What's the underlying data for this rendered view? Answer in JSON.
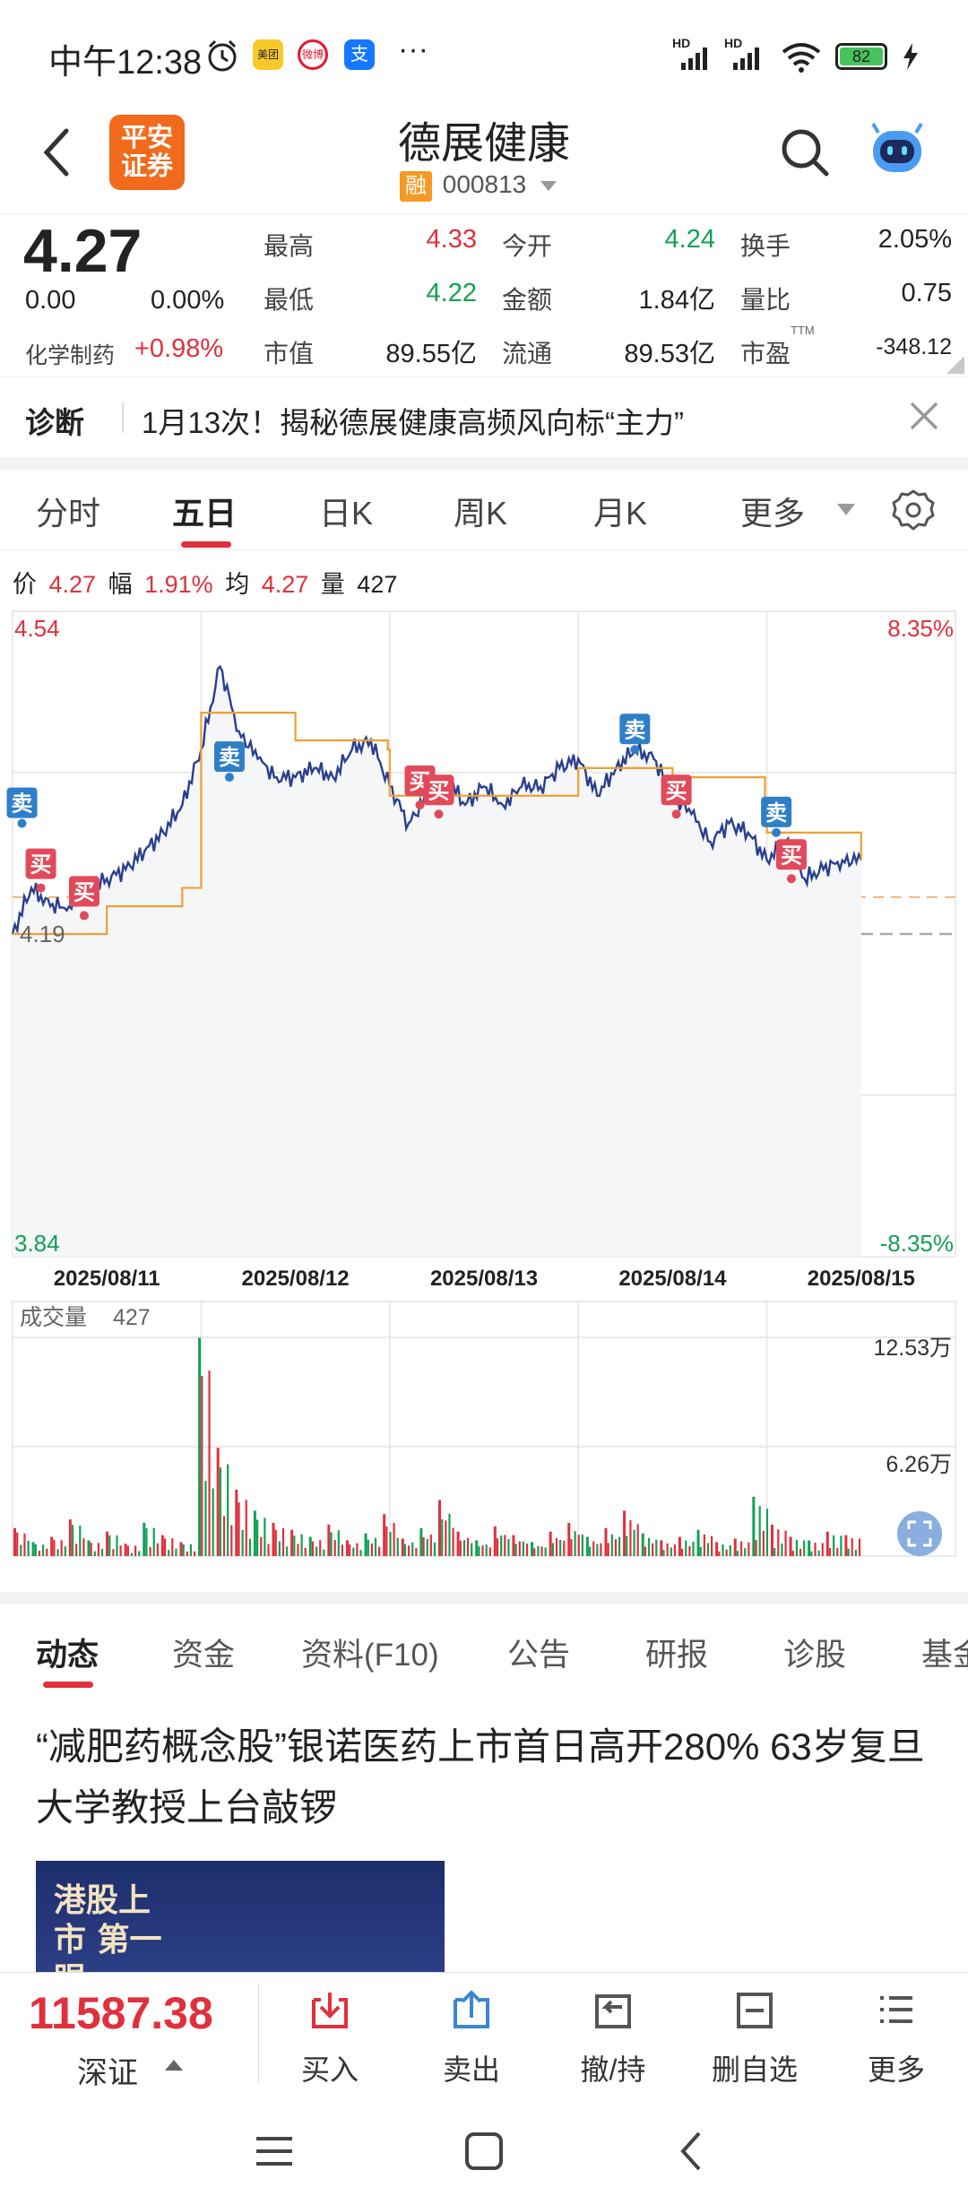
{
  "status_bar": {
    "time": "中午12:38",
    "app_badges": [
      "美团",
      "微博",
      "支"
    ],
    "more": "···",
    "network": [
      "HD",
      "HD"
    ],
    "battery": "82"
  },
  "header": {
    "logo_text": "平安证券",
    "stock_name": "德展健康",
    "rong_badge": "融",
    "stock_code": "000813"
  },
  "quote": {
    "price": "4.27",
    "change": "0.00",
    "change_pct": "0.00%",
    "sector_name": "化学制药",
    "sector_pct": "+0.98%",
    "rows": [
      {
        "l1": "最高",
        "v1": "4.33",
        "l2": "今开",
        "v2": "4.24",
        "l3": "换手",
        "v3": "2.05%"
      },
      {
        "l1": "最低",
        "v1": "4.22",
        "l2": "金额",
        "v2": "1.84亿",
        "l3": "量比",
        "v3": "0.75"
      },
      {
        "l1": "市值",
        "v1": "89.55亿",
        "l2": "流通",
        "v2": "89.53亿",
        "l3": "市盈",
        "v3": "-348.12"
      }
    ],
    "ttm": "TTM"
  },
  "diagnosis": {
    "tag": "诊断",
    "text": "1月13次！揭秘德展健康高频风向标“主力”"
  },
  "period_tabs": [
    "分时",
    "五日",
    "日K",
    "周K",
    "月K",
    "更多"
  ],
  "chart_info": {
    "price_label": "价",
    "price": "4.27",
    "amp_label": "幅",
    "amp": "1.91%",
    "avg_label": "均",
    "avg": "4.27",
    "vol_label": "量",
    "vol": "427"
  },
  "chart_data": {
    "type": "line",
    "title": "",
    "x_labels": [
      "2025/08/11",
      "2025/08/12",
      "2025/08/13",
      "2025/08/14",
      "2025/08/15"
    ],
    "ylim": [
      3.84,
      4.54
    ],
    "y_top_label": "4.54",
    "y_bottom_label": "3.84",
    "pct_top_label": "8.35%",
    "pct_bottom_label": "-8.35%",
    "prev_close": 4.19,
    "prev_close_label": "4.19",
    "grid": true,
    "series": [
      {
        "color": "#2a3f8f",
        "x": [
          0.0,
          0.1,
          0.2,
          0.3,
          0.4,
          0.5,
          0.6,
          0.7,
          0.8,
          0.9,
          1.0,
          1.1,
          1.2,
          1.3,
          1.4,
          1.5,
          1.6,
          1.7,
          1.8,
          1.9,
          2.0,
          2.1,
          2.2,
          2.3,
          2.4,
          2.5,
          2.6,
          2.7,
          2.8,
          2.9,
          3.0,
          3.1,
          3.2,
          3.3,
          3.4,
          3.5,
          3.6,
          3.7,
          3.8,
          3.9,
          4.0,
          4.1,
          4.2,
          4.3,
          4.4,
          4.5
        ],
        "values": [
          4.19,
          4.24,
          4.22,
          4.22,
          4.24,
          4.25,
          4.26,
          4.28,
          4.3,
          4.33,
          4.39,
          4.48,
          4.41,
          4.38,
          4.36,
          4.36,
          4.37,
          4.36,
          4.39,
          4.4,
          4.35,
          4.31,
          4.34,
          4.36,
          4.33,
          4.35,
          4.33,
          4.35,
          4.35,
          4.37,
          4.38,
          4.34,
          4.37,
          4.39,
          4.38,
          4.34,
          4.32,
          4.29,
          4.31,
          4.3,
          4.27,
          4.29,
          4.25,
          4.26,
          4.27,
          4.27
        ]
      },
      {
        "color": "#f0a030",
        "x": [
          0.0,
          0.5,
          0.9,
          1.0,
          1.5,
          1.99,
          2.0,
          2.5,
          2.99,
          3.0,
          3.5,
          3.99,
          4.0,
          4.5
        ],
        "values": [
          4.19,
          4.22,
          4.24,
          4.43,
          4.4,
          4.39,
          4.34,
          4.34,
          4.34,
          4.37,
          4.36,
          4.33,
          4.3,
          4.27
        ]
      }
    ],
    "trade_marks": [
      {
        "type": "卖",
        "x": 0.05,
        "y": 4.31
      },
      {
        "type": "买",
        "x": 0.15,
        "y": 4.24
      },
      {
        "type": "买",
        "x": 0.38,
        "y": 4.21
      },
      {
        "type": "卖",
        "x": 1.15,
        "y": 4.36
      },
      {
        "type": "买",
        "x": 2.16,
        "y": 4.33
      },
      {
        "type": "买",
        "x": 2.26,
        "y": 4.32
      },
      {
        "type": "卖",
        "x": 3.3,
        "y": 4.39
      },
      {
        "type": "买",
        "x": 3.52,
        "y": 4.32
      },
      {
        "type": "卖",
        "x": 4.05,
        "y": 4.3
      },
      {
        "type": "买",
        "x": 4.13,
        "y": 4.25
      }
    ],
    "volume": {
      "label": "成交量",
      "value": "427",
      "top_label": "12.53万",
      "mid_label": "6.26万",
      "ylim": [
        0,
        12.53
      ],
      "bars": [
        1.6,
        0.8,
        1.1,
        2.1,
        0.9,
        1.4,
        0.7,
        1.9,
        1.2,
        0.8,
        12.5,
        6.2,
        3.8,
        2.6,
        1.9,
        1.5,
        1.1,
        1.8,
        0.9,
        1.3,
        2.4,
        1.0,
        1.6,
        3.2,
        1.4,
        0.9,
        1.7,
        1.2,
        0.8,
        1.4,
        1.9,
        1.1,
        1.6,
        2.6,
        1.3,
        0.9,
        1.1,
        1.5,
        0.8,
        1.0,
        3.4,
        1.8,
        1.1,
        0.9,
        1.4,
        1.2
      ]
    }
  },
  "news_tabs": [
    "动态",
    "资金",
    "资料(F10)",
    "公告",
    "研报",
    "诊股",
    "基金"
  ],
  "news": {
    "title": "“减肥药概念股”银诺医药上市首日高开280% 63岁复旦大学教授上台敲锣",
    "thumb_text": "港股上市 第一眼"
  },
  "toolbar": {
    "index_value": "11587.38",
    "index_name": "深证",
    "buttons": [
      "买入",
      "卖出",
      "撤/持",
      "删自选",
      "更多"
    ]
  },
  "colors": {
    "up": "#e0303c",
    "down": "#12a055",
    "price_line": "#2a3f8f",
    "avg_line": "#f0a030",
    "sell_mark": "#2f7fc8",
    "buy_mark": "#e24a5a"
  }
}
